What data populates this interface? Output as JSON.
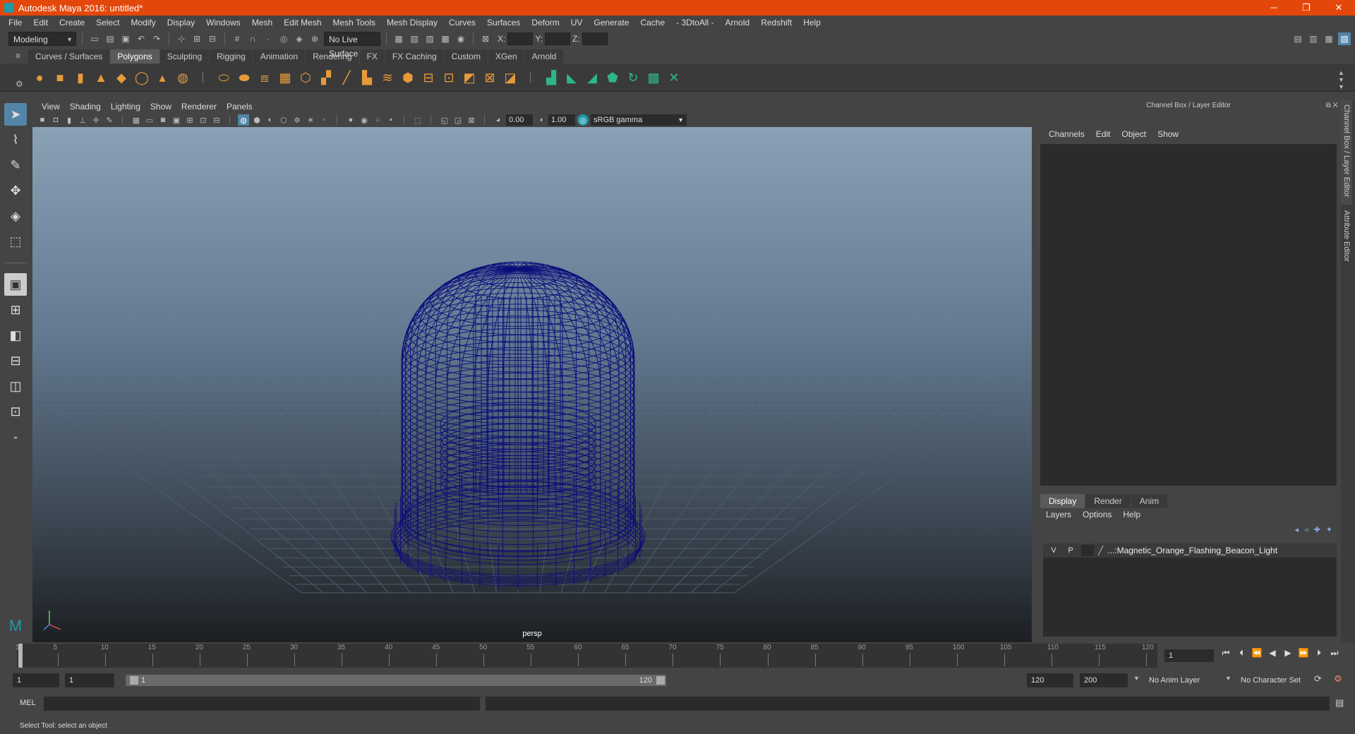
{
  "window": {
    "title": "Autodesk Maya 2016: untitled*",
    "minimize": "─",
    "restore": "❐",
    "close": "✕"
  },
  "menu": [
    "File",
    "Edit",
    "Create",
    "Select",
    "Modify",
    "Display",
    "Windows",
    "Mesh",
    "Edit Mesh",
    "Mesh Tools",
    "Mesh Display",
    "Curves",
    "Surfaces",
    "Deform",
    "UV",
    "Generate",
    "Cache",
    "- 3DtoAll -",
    "Arnold",
    "Redshift",
    "Help"
  ],
  "status": {
    "mode": "Modeling",
    "live_surface": "No Live Surface",
    "x_label": "X:",
    "y_label": "Y:",
    "z_label": "Z:"
  },
  "shelf": {
    "tabs": [
      "Curves / Surfaces",
      "Polygons",
      "Sculpting",
      "Rigging",
      "Animation",
      "Rendering",
      "FX",
      "FX Caching",
      "Custom",
      "XGen",
      "Arnold"
    ],
    "active": "Polygons",
    "icon_color_primary": "#e89a3a",
    "icon_color_secondary": "#2fb58a"
  },
  "viewport": {
    "menu": [
      "View",
      "Shading",
      "Lighting",
      "Show",
      "Renderer",
      "Panels"
    ],
    "exposure": "0.00",
    "gamma": "1.00",
    "colorspace": "sRGB gamma",
    "camera_label": "persp",
    "mesh_color": "#0b0d7a"
  },
  "channelbox": {
    "header": "Channel Box / Layer Editor",
    "menu": [
      "Channels",
      "Edit",
      "Object",
      "Show"
    ]
  },
  "layereditor": {
    "tabs": [
      "Display",
      "Render",
      "Anim"
    ],
    "active": "Display",
    "menu": [
      "Layers",
      "Options",
      "Help"
    ],
    "layer": {
      "v": "V",
      "p": "P",
      "name": "...:Magnetic_Orange_Flashing_Beacon_Light"
    }
  },
  "sidetabs": [
    "Channel Box / Layer Editor",
    "Attribute Editor"
  ],
  "timeline": {
    "ticks": [
      "1",
      "5",
      "10",
      "15",
      "20",
      "25",
      "30",
      "35",
      "40",
      "45",
      "50",
      "55",
      "60",
      "65",
      "70",
      "75",
      "80",
      "85",
      "90",
      "95",
      "100",
      "105",
      "110",
      "115",
      "120"
    ],
    "current_frame": "1"
  },
  "range": {
    "start": "1",
    "playback_start": "1",
    "range_start": "1",
    "range_end": "120",
    "playback_end": "120",
    "end": "200",
    "anim_layer": "No Anim Layer",
    "character_set": "No Character Set"
  },
  "mel": {
    "label": "MEL"
  },
  "statusbar": {
    "text": "Select Tool: select an object"
  }
}
